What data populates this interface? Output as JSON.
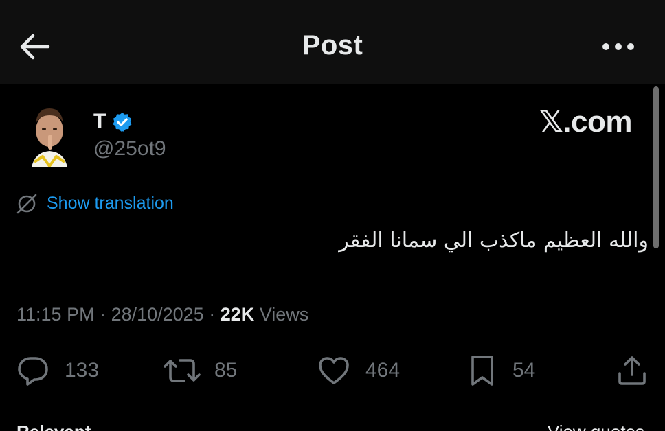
{
  "header": {
    "title": "Post",
    "back_icon": "arrow-left-icon",
    "more_icon": "more-horizontal-icon"
  },
  "author": {
    "name": "T",
    "handle": "@25ot9",
    "verified": true,
    "verified_color": "#1d9bf0"
  },
  "watermark": "𝕏.com",
  "translation": {
    "label": "Show translation",
    "icon": "globe-slash-icon",
    "color": "#1d9bf0"
  },
  "tweet": {
    "text": "والله العظيم ماكذب الي سمانا الفقر"
  },
  "meta": {
    "time": "11:15 PM",
    "sep1": " · ",
    "date": "28/10/2025",
    "sep2": " · ",
    "views_count": "22K",
    "views_label": " Views"
  },
  "actions": {
    "reply": {
      "icon": "reply-icon",
      "count": "133"
    },
    "repost": {
      "icon": "repost-icon",
      "count": "85"
    },
    "like": {
      "icon": "heart-icon",
      "count": "464"
    },
    "bookmark": {
      "icon": "bookmark-icon",
      "count": "54"
    },
    "share": {
      "icon": "share-icon"
    }
  },
  "footer": {
    "left": "Relevant",
    "right": "View quotes"
  },
  "colors": {
    "background": "#000000",
    "header_bg": "#0f0f0f",
    "text_primary": "#e7e9ea",
    "text_secondary": "#71767b",
    "accent": "#1d9bf0"
  }
}
